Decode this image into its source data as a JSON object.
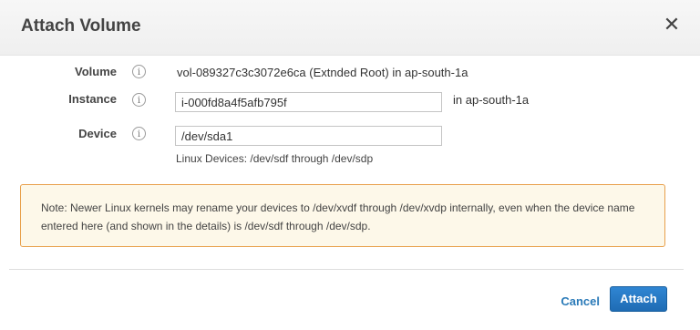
{
  "dialog": {
    "title": "Attach Volume",
    "close_glyph": "✕"
  },
  "volume": {
    "label": "Volume",
    "value": "vol-089327c3c3072e6ca (Extnded Root) in ap-south-1a"
  },
  "instance": {
    "label": "Instance",
    "value": "i-000fd8a4f5afb795f",
    "zone": "in ap-south-1a"
  },
  "device": {
    "label": "Device",
    "value": "/dev/sda1",
    "hint": "Linux Devices: /dev/sdf through /dev/sdp"
  },
  "info_glyph": "i",
  "note": {
    "text": "Note: Newer Linux kernels may rename your devices to /dev/xvdf through /dev/xvdp internally, even when the device name entered here (and shown in the details) is /dev/sdf through /dev/sdp."
  },
  "footer": {
    "cancel_label": "Cancel",
    "attach_label": "Attach"
  },
  "colors": {
    "primary_button": "#1f6cb4",
    "link": "#2a7ab8",
    "note_border": "#e8a04b",
    "note_background": "#fdf8e9"
  },
  "icons": [
    "close-icon",
    "info-icon"
  ]
}
